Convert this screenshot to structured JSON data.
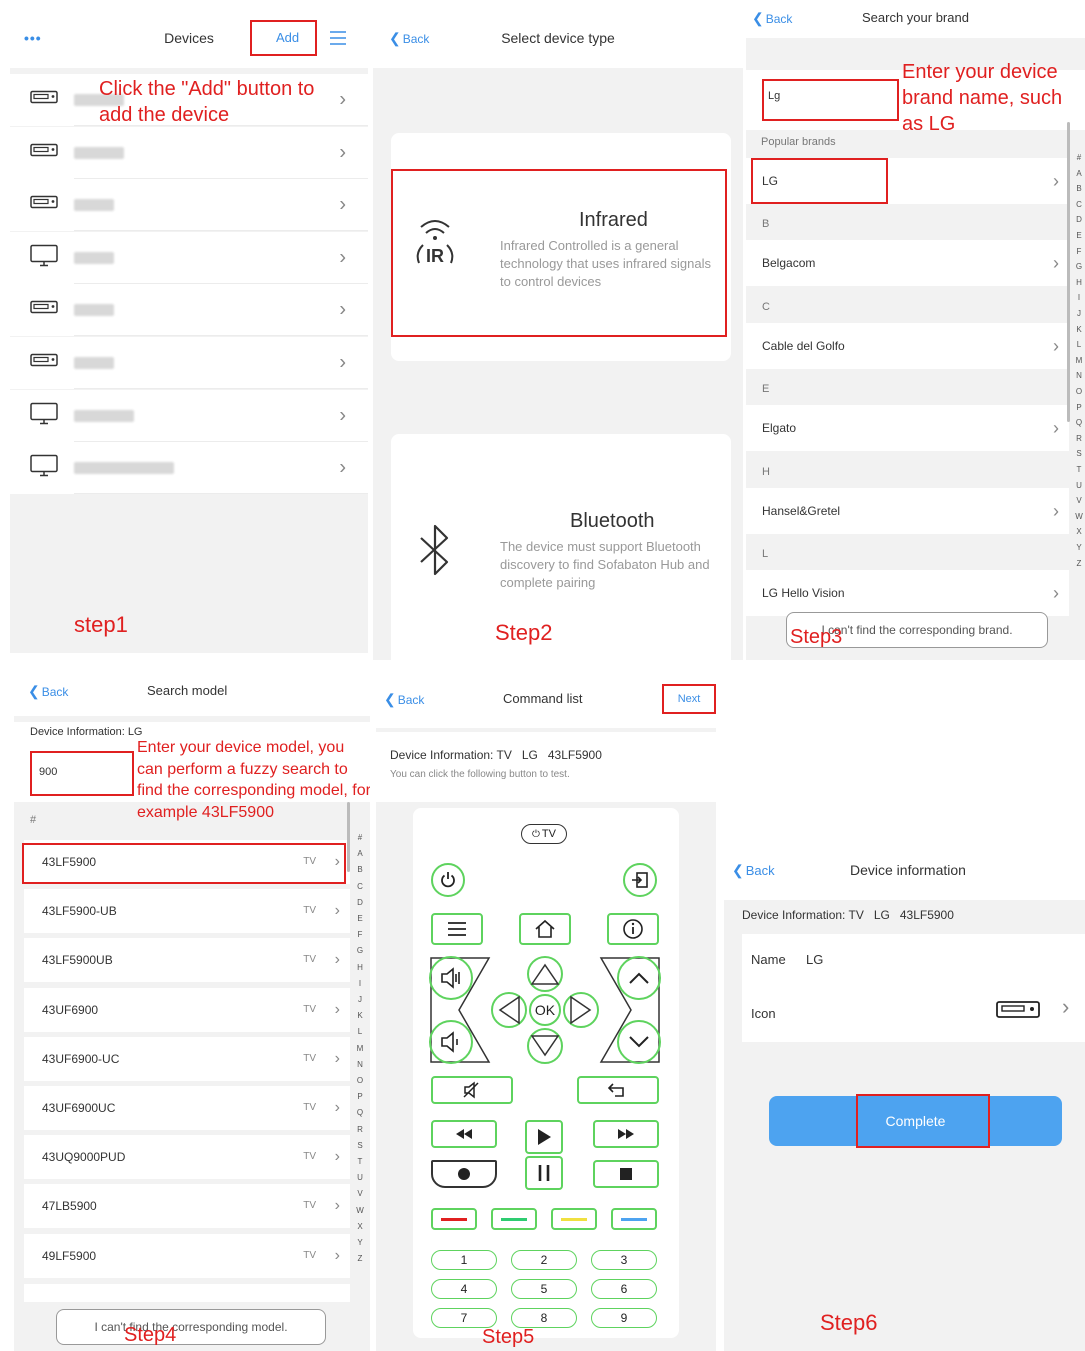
{
  "step1": {
    "menu_glyph": "•••",
    "title": "Devices",
    "add_label": "Add",
    "annotation": "Click the \"Add\" button to add the device",
    "step_label": "step1",
    "device_icons": [
      "stb-icon",
      "stb-icon",
      "stb-icon",
      "tv-icon",
      "stb-icon",
      "stb-icon",
      "tv-icon",
      "tv-icon"
    ]
  },
  "step2": {
    "back_label": "Back",
    "title": "Select device type",
    "infrared": {
      "title": "Infrared",
      "icon_text": "IR",
      "description": "Infrared Controlled is a  general technology that uses infrared signals to control devices"
    },
    "bluetooth": {
      "title": "Bluetooth",
      "description": "The device must support Bluetooth discovery to find Sofabaton Hub and complete pairing"
    },
    "step_label": "Step2"
  },
  "step3": {
    "back_label": "Back",
    "title": "Search your brand",
    "search_value": "Lg",
    "annotation": "Enter your device brand name, such as LG",
    "popular_header": "Popular brands",
    "popular_brand": "LG",
    "sections": [
      {
        "letter": "B",
        "brand": "Belgacom"
      },
      {
        "letter": "C",
        "brand": "Cable del Golfo"
      },
      {
        "letter": "E",
        "brand": "Elgato"
      },
      {
        "letter": "H",
        "brand": "Hansel&Gretel"
      },
      {
        "letter": "L",
        "brand": "LG Hello Vision"
      }
    ],
    "alphabet": [
      "#",
      "A",
      "B",
      "C",
      "D",
      "E",
      "F",
      "G",
      "H",
      "I",
      "J",
      "K",
      "L",
      "M",
      "N",
      "O",
      "P",
      "Q",
      "R",
      "S",
      "T",
      "U",
      "V",
      "W",
      "X",
      "Y",
      "Z"
    ],
    "cant_find": "I can't find the corresponding brand.",
    "step_label": "Step3"
  },
  "step4": {
    "back_label": "Back",
    "title": "Search model",
    "device_info": "Device Information: LG",
    "search_value": "900",
    "annotation": "Enter your device model, you can perform a fuzzy search to find the corresponding model, for example 43LF5900",
    "section_header": "#",
    "models": [
      "43LF5900",
      "43LF5900-UB",
      "43LF5900UB",
      "43UF6900",
      "43UF6900-UC",
      "43UF6900UC",
      "43UQ9000PUD",
      "47LB5900",
      "49LF5900"
    ],
    "type_label": "TV",
    "alphabet": [
      "#",
      "A",
      "B",
      "C",
      "D",
      "E",
      "F",
      "G",
      "H",
      "I",
      "J",
      "K",
      "L",
      "M",
      "N",
      "O",
      "P",
      "Q",
      "R",
      "S",
      "T",
      "U",
      "V",
      "W",
      "X",
      "Y",
      "Z"
    ],
    "cant_find": "I can't find the corresponding model.",
    "step_label": "Step4"
  },
  "step5": {
    "back_label": "Back",
    "title": "Command list",
    "next_label": "Next",
    "device_info": "Device Information: TV   LG   43LF5900",
    "hint": "You can click the following button to test.",
    "tv_label": "TV",
    "ok_label": "OK",
    "numbers": [
      "1",
      "2",
      "3",
      "4",
      "5",
      "6",
      "7",
      "8",
      "9"
    ],
    "color_keys": [
      "#e02020",
      "#2ecc71",
      "#f0e040",
      "#4da3f0"
    ],
    "step_label": "Step5"
  },
  "step6": {
    "back_label": "Back",
    "title": "Device information",
    "device_info": "Device Information: TV   LG   43LF5900",
    "name_label": "Name",
    "name_value": "LG",
    "icon_label": "Icon",
    "complete_label": "Complete",
    "step_label": "Step6"
  },
  "colors": {
    "accent_blue": "#3a8ee6",
    "annotation_red": "#e02020",
    "remote_green": "#5ed35e",
    "complete_blue": "#4da3f0"
  }
}
